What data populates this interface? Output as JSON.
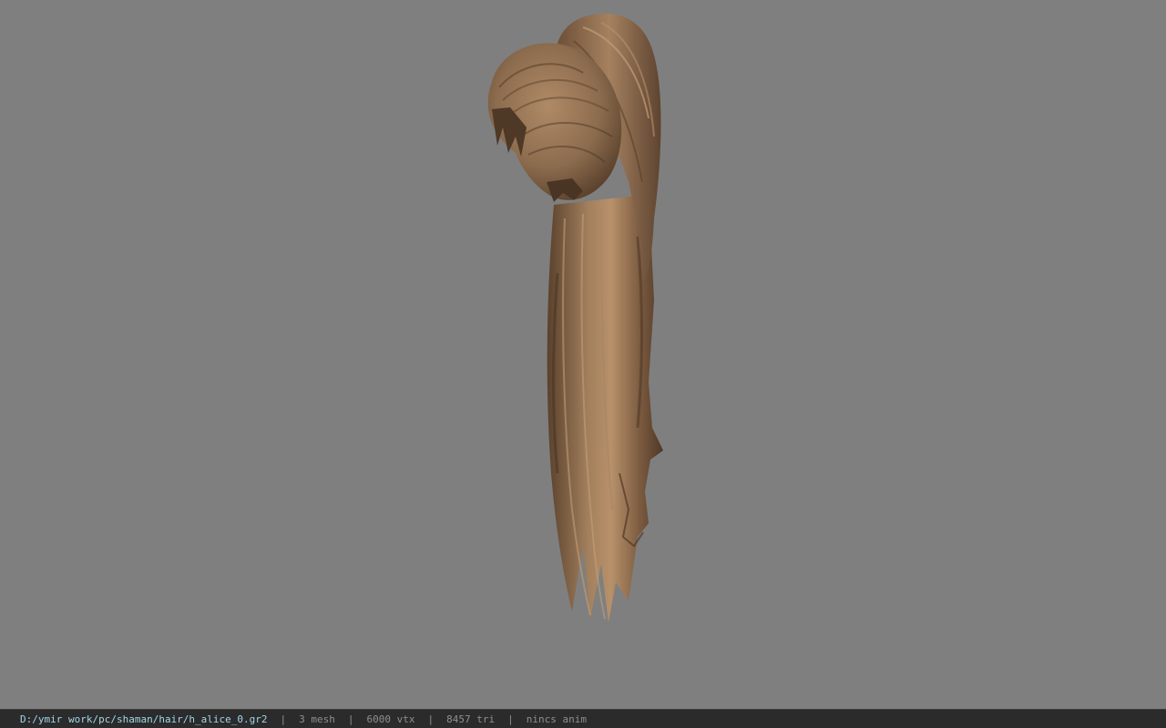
{
  "viewport": {
    "background_color": "#7f7f7f",
    "model_name": "hair mesh (ponytail)",
    "model_colors": {
      "base": "#8c6c4e",
      "light": "#b08a66",
      "dark": "#4e3826"
    }
  },
  "statusbar": {
    "file_path": "D:/ymir work/pc/shaman/hair/h_alice_0.gr2",
    "separator": "|",
    "mesh_count": "3 mesh",
    "vertex_count": "6000 vtx",
    "triangle_count": "8457 tri",
    "anim_status": "nincs anim",
    "path_color": "#9fd6ea"
  }
}
